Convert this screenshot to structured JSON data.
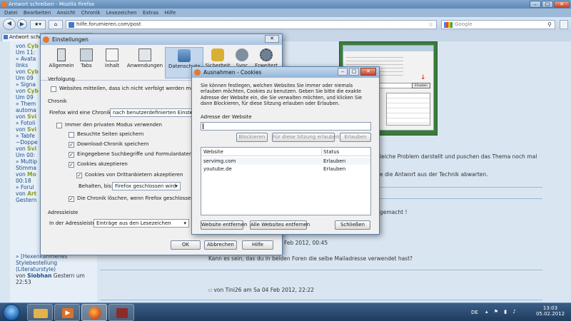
{
  "browser": {
    "window_title": "Antwort schreiben - Mozilla Firefox",
    "menu": [
      "Datei",
      "Bearbeiten",
      "Ansicht",
      "Chronik",
      "Lesezeichen",
      "Extras",
      "Hilfe"
    ],
    "url": "hilfe.forumieren.com/post",
    "search_engine": "Google",
    "search_placeholder": "Google",
    "tab_label": "Antwort schreiben"
  },
  "page": {
    "sidebar": [
      {
        "pre": "von ",
        "user": "Cyb",
        "post": ""
      },
      {
        "pre": "Um 11:",
        "user": "",
        "post": ""
      },
      {
        "pre": "» Avata",
        "user": "",
        "post": ""
      },
      {
        "pre": "links",
        "user": "",
        "post": ""
      },
      {
        "pre": "von ",
        "user": "Cyb",
        "post": ""
      },
      {
        "pre": "Um 09",
        "user": "",
        "post": ""
      },
      {
        "pre": "» Signa",
        "user": "",
        "post": ""
      },
      {
        "pre": "von ",
        "user": "Cyb",
        "post": ""
      },
      {
        "pre": "Um 09",
        "user": "",
        "post": ""
      },
      {
        "pre": "» Them",
        "user": "",
        "post": ""
      },
      {
        "pre": "automa",
        "user": "",
        "post": ""
      },
      {
        "pre": "von ",
        "user": "Svi",
        "post": ""
      },
      {
        "pre": "» Fotoli",
        "user": "",
        "post": ""
      },
      {
        "pre": "von ",
        "user": "Svi",
        "post": ""
      },
      {
        "pre": "» Tabfe",
        "user": "",
        "post": ""
      },
      {
        "pre": "~Doppe",
        "user": "",
        "post": ""
      },
      {
        "pre": "von ",
        "user": "Svi",
        "post": ""
      },
      {
        "pre": "Um 00:",
        "user": "",
        "post": ""
      },
      {
        "pre": "» Multip",
        "user": "",
        "post": ""
      },
      {
        "pre": "Stimma",
        "user": "",
        "post": ""
      },
      {
        "pre": "von ",
        "user": "Mo",
        "post": ""
      },
      {
        "pre": "00:18",
        "user": "",
        "post": ""
      },
      {
        "pre": "» Forul",
        "user": "",
        "post": ""
      },
      {
        "pre": "von ",
        "user": "Art",
        "post": ""
      },
      {
        "pre": "Gestern",
        "user": "",
        "post": ""
      }
    ],
    "sidebar_last": [
      "» [Hexenkahmenes",
      "Stylebestellung",
      "(Literaturstyle)"
    ],
    "sidebar_last_by": "von ",
    "sidebar_last_user": "Siobhan",
    "sidebar_last_time": " Gestern um",
    "sidebar_last_time2": "22:53",
    "post_line1": "leiche Problem darstellt und puschen das Thema noch mal",
    "post_line2": "e die Antwort aus der Technik abwarten.",
    "post_line3": "gemacht !",
    "post_meta": "Feb 2012, 00:45",
    "post_line4": "Kann es sein, das du in beiden Foren die selbe Mailadresse verwendet hast?",
    "post_meta2": "von Tini26 am Sa 04 Feb 2012, 22:22",
    "screenshot_btn": "Erlauben"
  },
  "settings": {
    "title": "Einstellungen",
    "tabs": [
      "Allgemein",
      "Tabs",
      "Inhalt",
      "Anwendungen",
      "Datenschutz",
      "Sicherheit",
      "Sync",
      "Erweitert"
    ],
    "verfolgung": "Verfolgung",
    "dnt": "Websites mitteilen, dass ich nicht verfolgt werden möchte",
    "chronik": "Chronik",
    "firefox_will": "Firefox wird eine Chronik:",
    "chronik_select": "nach benutzerdefinierten Einstellung",
    "private": "Immer den privaten Modus verwenden",
    "besuchte": "Besuchte Seiten speichern",
    "download": "Download-Chronik speichern",
    "suchbegriffe": "Eingegebene Suchbegriffe und Formulardaten speic",
    "cookies": "Cookies akzeptieren",
    "drittanbieter": "Cookies von Drittanbietern akzeptieren",
    "behalten": "Behalten, bis:",
    "behalten_select": "Firefox geschlossen wird",
    "loeschen": "Die Chronik löschen, wenn Firefox geschlossen wird",
    "adressleiste": "Adressleiste",
    "in_der": "In der Adressleiste",
    "adress_select": "Einträge aus den Lesezeichen",
    "ok": "OK",
    "abbrechen": "Abbrechen",
    "hilfe": "Hilfe"
  },
  "cookies": {
    "title": "Ausnahmen - Cookies",
    "description": "Sie können festlegen, welchen Websites Sie immer oder niemals erlauben möchten, Cookies zu benutzen. Geben Sie bitte die exakte Adresse der Website ein, die Sie verwalten möchten, und klicken Sie dann Blockieren, für diese Sitzung erlauben oder Erlauben.",
    "address_label": "Adresse der Website",
    "address_value": "",
    "block": "Blockieren",
    "session": "Für diese Sitzung erlauben",
    "allow": "Erlauben",
    "col_website": "Website",
    "col_status": "Status",
    "rows": [
      {
        "site": "servimg.com",
        "status": "Erlauben"
      },
      {
        "site": "youtube.de",
        "status": "Erlauben"
      }
    ],
    "remove": "Website entfernen",
    "remove_all": "Alle Websites entfernen",
    "close": "Schließen"
  },
  "taskbar": {
    "lang": "DE",
    "time": "13:03",
    "date": "05.02.2012"
  }
}
